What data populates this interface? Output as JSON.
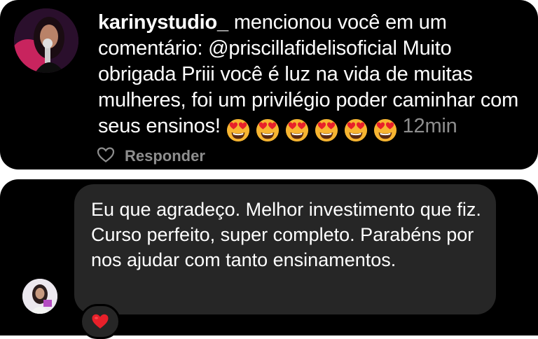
{
  "comment_notification": {
    "username": "karinystudio_",
    "action_text": " mencionou você em um comentário: ",
    "mention": "@priscillafidelisoficial",
    "comment_text": " Muito obrigada Priii você é luz na vida de muitas mulheres, foi um privilégio poder caminhar com seus ensinos! ",
    "emoji": "heart-eyes-emoji",
    "emoji_count": 6,
    "time": "12min",
    "like_icon": "heart-outline-icon",
    "reply_label": "Responder"
  },
  "reply_message": {
    "text": "Eu que agradeço. Melhor investimento que fiz.  Curso perfeito, super completo. Parabéns por nos ajudar com tanto ensinamentos.",
    "reaction": "red-heart-emoji"
  },
  "colors": {
    "background": "#000000",
    "bubble": "#262626",
    "muted_text": "#8e8e8e",
    "heart_red": "#e8202a",
    "emoji_yellow": "#f7b531"
  }
}
